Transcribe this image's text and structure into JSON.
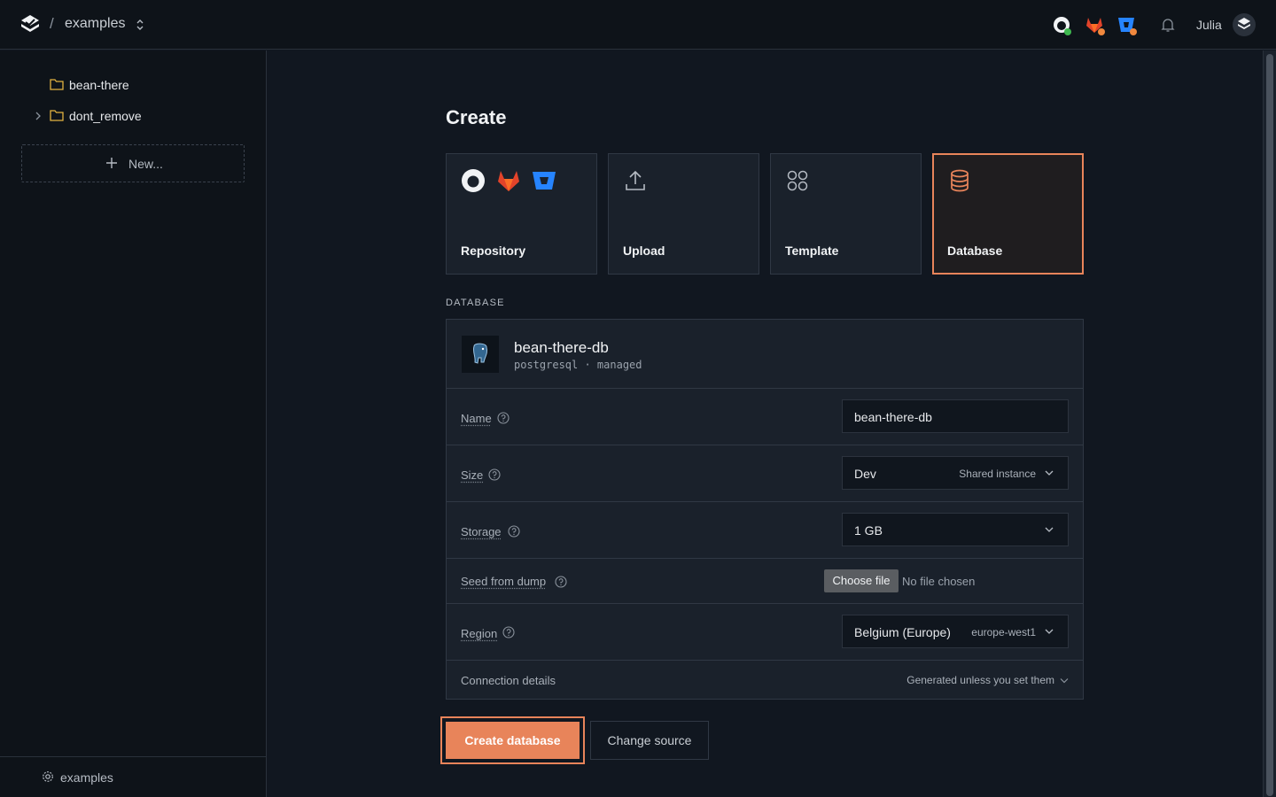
{
  "header": {
    "separator": "/",
    "project": "examples",
    "user": "Julia",
    "icons": [
      "github-icon",
      "gitlab-icon",
      "bitbucket-icon",
      "bell-icon"
    ]
  },
  "sidebar": {
    "items": [
      {
        "label": "bean-there",
        "expandable": false
      },
      {
        "label": "dont_remove",
        "expandable": true
      }
    ],
    "new_label": "New...",
    "footer_label": "examples"
  },
  "main": {
    "title": "Create",
    "sources": [
      {
        "label": "Repository",
        "icon": "git-providers-icon",
        "selected": false
      },
      {
        "label": "Upload",
        "icon": "upload-icon",
        "selected": false
      },
      {
        "label": "Template",
        "icon": "template-grid-icon",
        "selected": false
      },
      {
        "label": "Database",
        "icon": "database-icon",
        "selected": true
      }
    ],
    "section_label": "DATABASE",
    "database": {
      "name": "bean-there-db",
      "meta": "postgresql · managed"
    },
    "fields": {
      "name": {
        "label": "Name",
        "value": "bean-there-db"
      },
      "size": {
        "label": "Size",
        "value": "Dev",
        "hint": "Shared instance"
      },
      "storage": {
        "label": "Storage",
        "value": "1 GB"
      },
      "seed": {
        "label": "Seed from dump",
        "button": "Choose file",
        "status": "No file chosen"
      },
      "region": {
        "label": "Region",
        "value": "Belgium (Europe)",
        "hint": "europe-west1"
      },
      "connection": {
        "label": "Connection details",
        "hint": "Generated unless you set them"
      }
    },
    "actions": {
      "create": "Create database",
      "change": "Change source"
    }
  },
  "colors": {
    "accent": "#e8845a",
    "background": "#111720",
    "panel": "#1a212b",
    "folder": "#e3b341"
  }
}
